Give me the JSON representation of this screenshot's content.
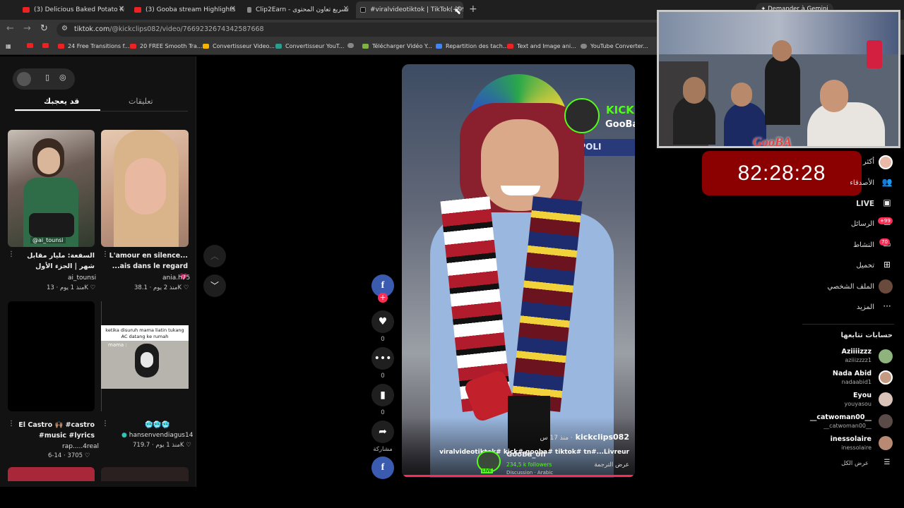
{
  "browser": {
    "tabs": [
      {
        "title": "(3) Delicious Baked Potato Kum"
      },
      {
        "title": "(3) Gooba stream Highlights#4"
      },
      {
        "title": "Clip2Earn - تسريع تعاون المحتوى"
      },
      {
        "title": "#viralvideotiktok | TikTok(+99)"
      }
    ],
    "url_host": "tiktok.com",
    "url_path": "/@kickclips082/video/7669232674342587668",
    "gemini_label": "Demander à Gemini",
    "bookmarks": [
      "24 Free Transitions f...",
      "20 FREE Smooth Tra...",
      "Convertisseur Video...",
      "Convertisseur YouT...",
      "Télécharger Vidéo Y...",
      "Repartition des tach...",
      "Text and Image ani...",
      "YouTube Converter..."
    ]
  },
  "left_panel": {
    "tab_liked": "قد يعجبك",
    "tab_comments": "تعليقات",
    "videos": [
      {
        "title": "السفعة: مليار مقابل شهر | الجزء الأول",
        "author": "ai_tounsi",
        "likes": "13K",
        "age": "منذ 1 يوم",
        "overlay": "@ai_tounsi"
      },
      {
        "title": "L'amour en silence... ...ais dans le regard 💗",
        "author": "ania.h75",
        "likes": "38.1K",
        "age": "منذ 2 يوم"
      },
      {
        "title": "El Castro 🙌🏽 #castro #music #lyrics",
        "author": "rap.....4real",
        "likes": "3705",
        "age": "6-14"
      },
      {
        "title": "🥶🥶🥶",
        "author": "hansenvendiagus14",
        "likes": "719.7K",
        "age": "منذ 1 يوم",
        "caption": "ketika disuruh mama liatin tukang AC datang ke rumah",
        "caption2": "mama :"
      }
    ]
  },
  "player": {
    "actions": [
      {
        "icon": "heart-icon",
        "count": "0"
      },
      {
        "icon": "comment-icon",
        "count": "0"
      },
      {
        "icon": "bookmark-icon",
        "count": "0"
      },
      {
        "icon": "share-icon",
        "count": "مشاركة"
      }
    ],
    "overlay_author": "kickclips082",
    "overlay_age": "منذ 17 س ·",
    "overlay_caption": "viralvideotiktok# kick# gooba# tiktok# tn#...Livreur",
    "overlay_translate": "عرض الترجمة",
    "kick_name": "GooBa",
    "kick_followers": "234,5 k followers",
    "kick_channel": "GooBa_off",
    "kick_tags": [
      "Discussion",
      "Arabic"
    ],
    "kick_live": "LIVE"
  },
  "right_nav": {
    "items": [
      {
        "label": "أكثر"
      },
      {
        "label": "الأصدقاء"
      },
      {
        "label": "LIVE"
      },
      {
        "label": "الرسائل",
        "badge": "+99"
      },
      {
        "label": "النشاط",
        "badge": "70"
      },
      {
        "label": "تحميل"
      },
      {
        "label": "الملف الشخصي"
      },
      {
        "label": "المزيد"
      }
    ],
    "following_heading": "حسابات تتابعها",
    "accounts": [
      {
        "name": "Aziiiizzz",
        "handle": "aziiizzzz1"
      },
      {
        "name": "Nada Abid",
        "handle": "nadaabid1"
      },
      {
        "name": "Eyou",
        "handle": "youyasou"
      },
      {
        "name": "__catwoman00__",
        "handle": "__catwoman00__"
      },
      {
        "name": "inessolaire",
        "handle": "inessolaire"
      }
    ],
    "see_all": "عرض الكل"
  },
  "stream_overlay": {
    "timer": "82:28:28",
    "logo": "GooBA"
  },
  "colors": {
    "accent": "#fe2c55",
    "timer_bg": "#8b0000"
  }
}
